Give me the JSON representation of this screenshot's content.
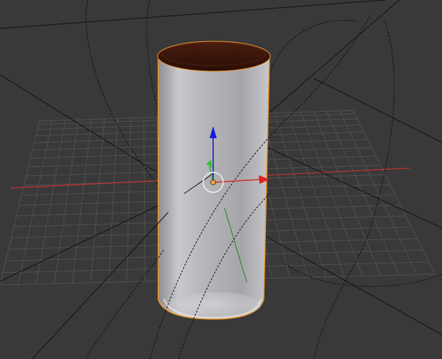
{
  "viewport": {
    "shading": "solid",
    "selected_object": {
      "type": "cylinder",
      "body_color": "#b9b9be",
      "cap_color": "#3a1409",
      "outline_color": "#f2982c"
    },
    "colors": {
      "background": "#393939",
      "grid": "#555555",
      "x_axis": "#c83232",
      "y_axis": "#2f8a2f",
      "z_axis": "#1a1ae0",
      "origin": "#f2a23a",
      "camera_lines": "#111111"
    },
    "gizmo": {
      "x_icon": "red-cone-arrow",
      "y_icon": "green-cone-arrow",
      "z_icon": "blue-cone-arrow",
      "pivot": "white-circle"
    }
  }
}
